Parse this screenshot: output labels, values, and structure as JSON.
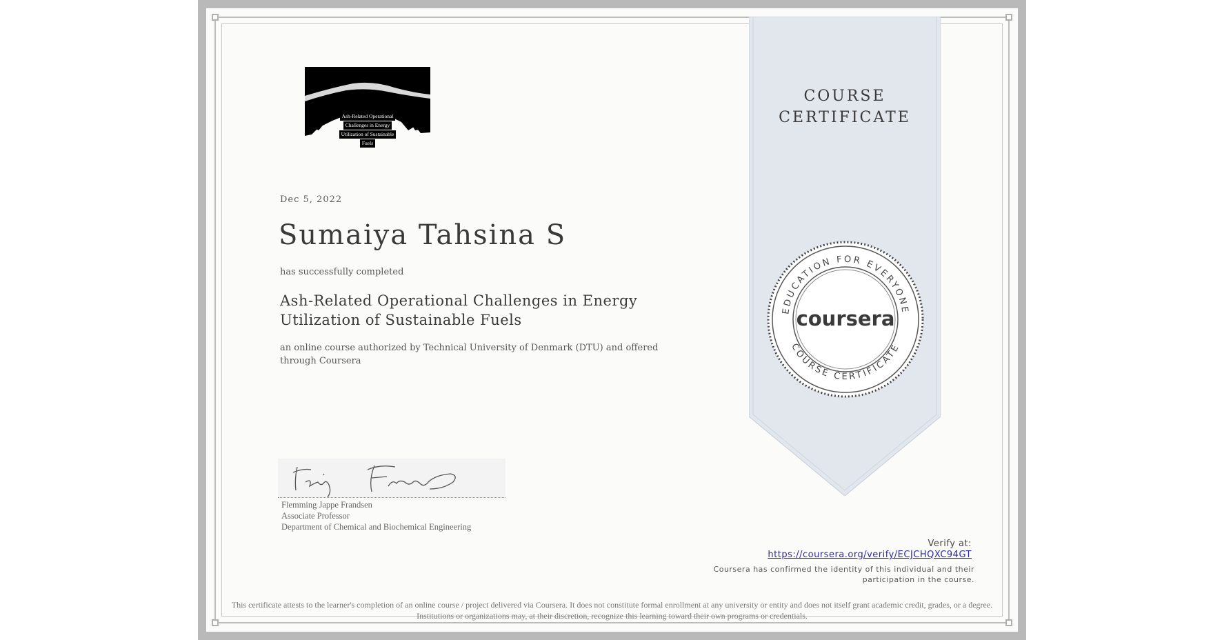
{
  "logo": {
    "lines": [
      "Ash-Related Operational",
      "Challenges in Energy",
      "Utilization of Sustainable",
      "Fuels"
    ]
  },
  "certificate": {
    "date": "Dec 5, 2022",
    "recipient": "Sumaiya Tahsina S",
    "completed_text": "has successfully completed",
    "course_title": "Ash-Related Operational Challenges in Energy Utilization of Sustainable Fuels",
    "authorized_text": "an online course authorized by Technical University of Denmark (DTU) and offered through Coursera"
  },
  "ribbon": {
    "line1": "COURSE",
    "line2": "CERTIFICATE"
  },
  "seal": {
    "top_text": "EDUCATION FOR EVERYONE",
    "bottom_text": "COURSE CERTIFICATE",
    "brand": "coursera"
  },
  "signatory": {
    "name": "Flemming Jappe Frandsen",
    "title": "Associate Professor",
    "department": "Department of Chemical and Biochemical Engineering"
  },
  "verify": {
    "label": "Verify at:",
    "url": "https://coursera.org/verify/ECJCHQXC94GT",
    "confirmation": "Coursera has confirmed the identity of this individual and their participation in the course."
  },
  "disclaimer": "This certificate attests to the learner's completion of an online course / project delivered via Coursera. It does not constitute formal enrollment at any university or entity and does not itself grant academic credit, grades, or a degree. Institutions or organizations may, at their discretion, recognize this learning toward their own programs or credentials.",
  "colors": {
    "frame": "#b9b9b9",
    "ribbon": "#e2e7ee",
    "text": "#3a3a3a",
    "link": "#2a2a9a"
  }
}
